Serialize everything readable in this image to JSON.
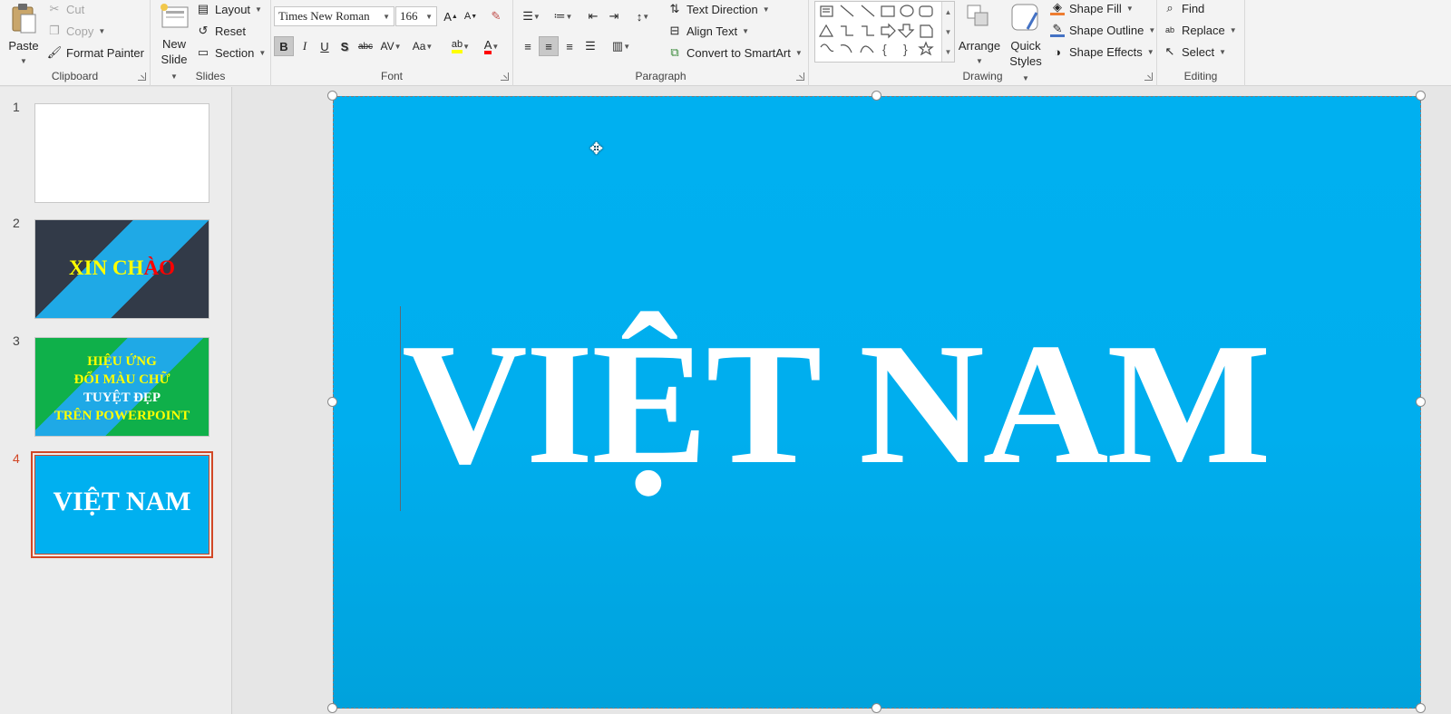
{
  "clipboard": {
    "paste": "Paste",
    "cut": "Cut",
    "copy": "Copy",
    "format_painter": "Format Painter",
    "label": "Clipboard"
  },
  "slides_group": {
    "new_slide": "New",
    "new_slide_2": "Slide",
    "layout": "Layout",
    "reset": "Reset",
    "section": "Section",
    "label": "Slides"
  },
  "font": {
    "family": "Times New Roman",
    "size": "166",
    "bold": "B",
    "italic": "I",
    "underline": "U",
    "shadow": "S",
    "strike": "abc",
    "spacing": "AV",
    "case": "Aa",
    "grow": "A",
    "shrink": "A",
    "label": "Font",
    "highlight_color": "#ffff00",
    "font_color": "#ff0000"
  },
  "paragraph": {
    "text_direction": "Text Direction",
    "align_text": "Align Text",
    "convert_smartart": "Convert to SmartArt",
    "label": "Paragraph"
  },
  "drawing": {
    "arrange": "Arrange",
    "quick": "Quick",
    "styles": "Styles",
    "shape_fill": "Shape Fill",
    "shape_outline": "Shape Outline",
    "shape_effects": "Shape Effects",
    "label": "Drawing"
  },
  "editing": {
    "find": "Find",
    "replace": "Replace",
    "select": "Select",
    "label": "Editing"
  },
  "thumbnails": [
    {
      "num": "1",
      "text": ""
    },
    {
      "num": "2",
      "text_a": "XIN CH",
      "text_b": "ÀO"
    },
    {
      "num": "3",
      "lines": [
        "HIỆU ỨNG",
        "ĐỔI MÀU CHỮ",
        "TUYỆT ĐẸP",
        "TRÊN POWERPOINT"
      ]
    },
    {
      "num": "4",
      "text": "VIỆT NAM"
    }
  ],
  "slide": {
    "title": "VIỆT NAM",
    "background": "#00b0f0"
  },
  "colors": {
    "accent": "#d24726",
    "thumb2_dark": "#323a48",
    "thumb2_blue": "#1fa9e6",
    "thumb3_green": "#0fb04a",
    "thumb3_blue": "#1fa9e6"
  }
}
